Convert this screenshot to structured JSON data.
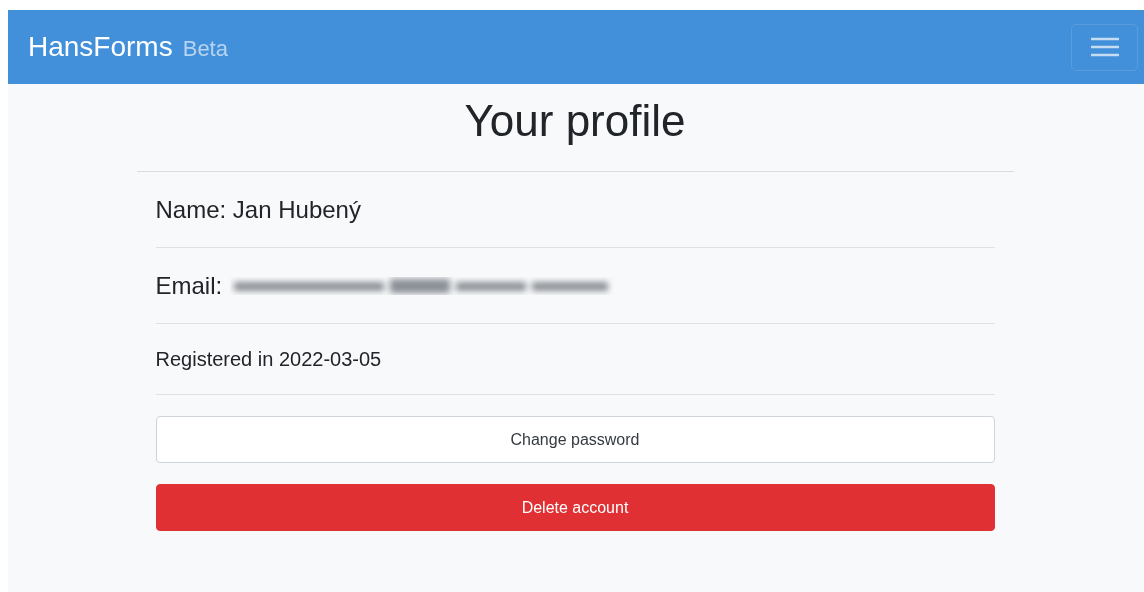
{
  "navbar": {
    "brand": "HansForms",
    "badge": "Beta"
  },
  "page": {
    "title": "Your profile"
  },
  "fields": [
    {
      "kind": "text",
      "label": "Name:",
      "value": "Jan Hubený"
    },
    {
      "kind": "redacted",
      "label": "Email:"
    },
    {
      "kind": "note",
      "label": "Registered in",
      "value": "2022-03-05"
    }
  ],
  "buttons": [
    {
      "kind": "outline",
      "label": "Change password"
    },
    {
      "kind": "danger",
      "label": "Delete account"
    }
  ]
}
